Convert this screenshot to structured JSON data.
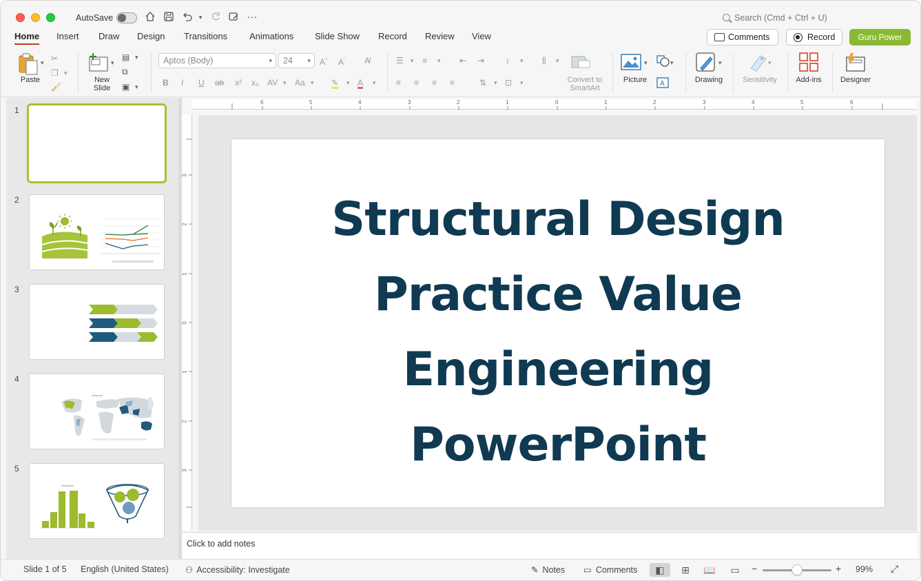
{
  "titlebar": {
    "autosave_label": "AutoSave",
    "search_placeholder": "Search (Cmd + Ctrl + U)"
  },
  "tabs": [
    "Home",
    "Insert",
    "Draw",
    "Design",
    "Transitions",
    "Animations",
    "Slide Show",
    "Record",
    "Review",
    "View"
  ],
  "actions": {
    "comments": "Comments",
    "record": "Record",
    "guru": "Guru Power"
  },
  "ribbon": {
    "paste": "Paste",
    "new_slide": "New Slide",
    "font_name": "Aptos (Body)",
    "font_size": "24",
    "convert_smartart": "Convert to SmartArt",
    "picture": "Picture",
    "drawing": "Drawing",
    "sensitivity": "Sensitivity",
    "addins": "Add-ins",
    "designer": "Designer"
  },
  "thumbnails": [
    "1",
    "2",
    "3",
    "4",
    "5"
  ],
  "slide": {
    "title_lines": [
      "Structural Design",
      "Practice Value",
      "Engineering",
      "PowerPoint"
    ]
  },
  "ruler": {
    "h_labels": [
      "6",
      "5",
      "4",
      "3",
      "2",
      "1",
      "0",
      "1",
      "2",
      "3",
      "4",
      "5",
      "6"
    ],
    "v_labels": [
      "3",
      "2",
      "1",
      "0",
      "1",
      "2",
      "3"
    ]
  },
  "notes_placeholder": "Click to add notes",
  "status": {
    "slide_count": "Slide 1 of 5",
    "language": "English (United States)",
    "accessibility": "Accessibility: Investigate",
    "notes": "Notes",
    "comments": "Comments",
    "zoom": "99%"
  },
  "colors": {
    "accent": "#c43e1c",
    "guru": "#8ab933",
    "title": "#0f3a52",
    "thumb_selected": "#b1bd2f"
  }
}
